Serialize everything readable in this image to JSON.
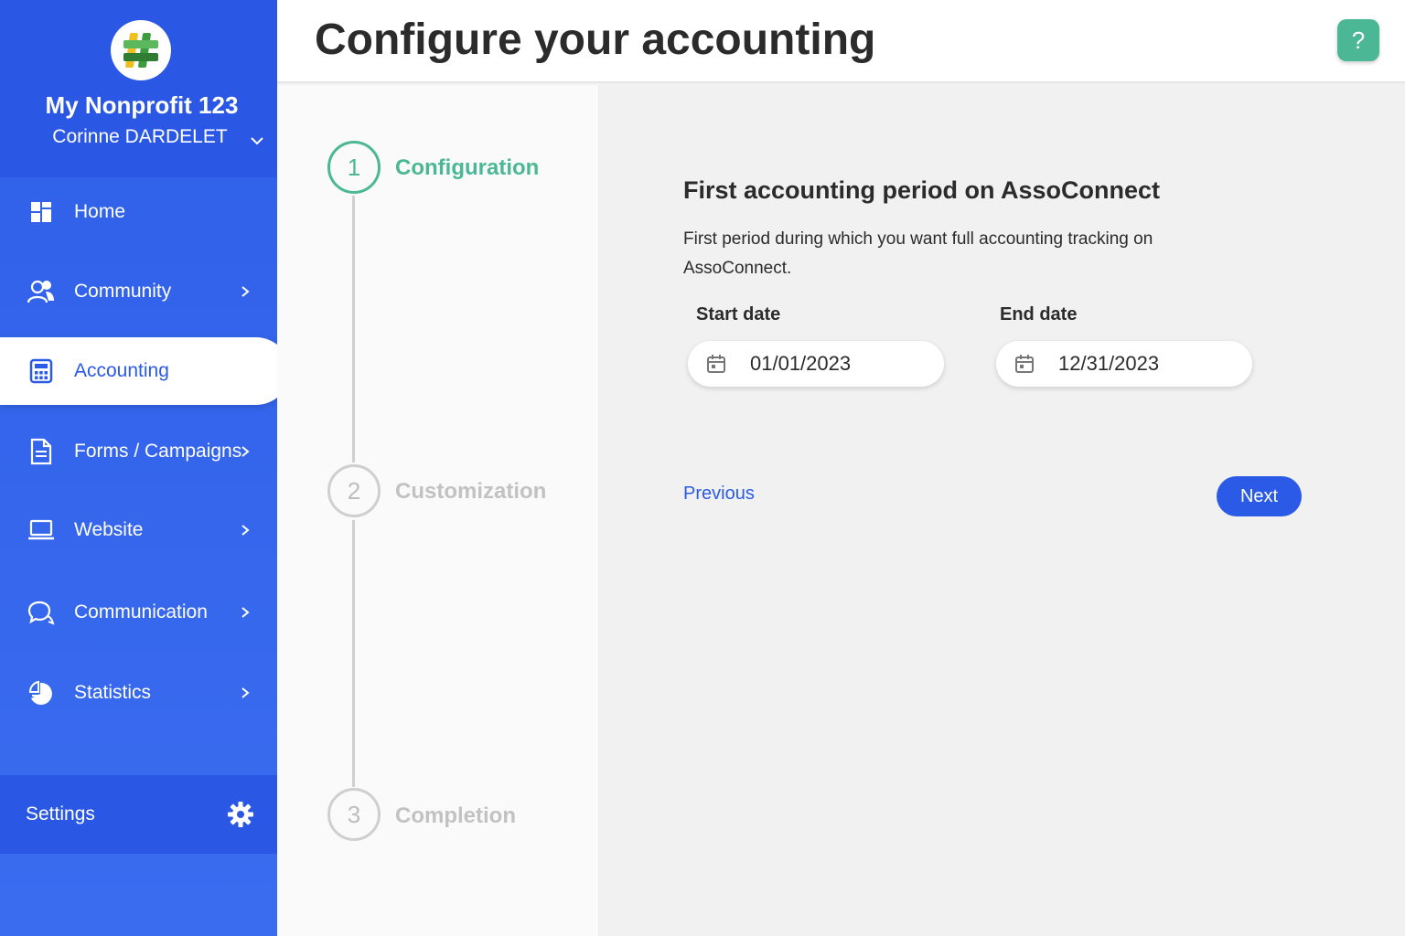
{
  "header": {
    "title": "Configure your accounting",
    "help_label": "?"
  },
  "sidebar": {
    "org_name": "My Nonprofit 123",
    "user_name": "Corinne DARDELET",
    "items": [
      {
        "label": "Home",
        "icon": "grid-icon",
        "has_chevron": false,
        "active": false
      },
      {
        "label": "Community",
        "icon": "users-icon",
        "has_chevron": true,
        "active": false
      },
      {
        "label": "Accounting",
        "icon": "calculator-icon",
        "has_chevron": false,
        "active": true
      },
      {
        "label": "Forms / Campaigns",
        "icon": "document-icon",
        "has_chevron": true,
        "active": false
      },
      {
        "label": "Website",
        "icon": "laptop-icon",
        "has_chevron": true,
        "active": false
      },
      {
        "label": "Communication",
        "icon": "chat-icon",
        "has_chevron": true,
        "active": false
      },
      {
        "label": "Statistics",
        "icon": "pie-chart-icon",
        "has_chevron": true,
        "active": false
      }
    ],
    "settings_label": "Settings"
  },
  "stepper": {
    "steps": [
      {
        "number": "1",
        "label": "Configuration",
        "active": true
      },
      {
        "number": "2",
        "label": "Customization",
        "active": false
      },
      {
        "number": "3",
        "label": "Completion",
        "active": false
      }
    ]
  },
  "main": {
    "section_title": "First accounting period on AssoConnect",
    "section_desc": "First period during which you want full accounting tracking on AssoConnect.",
    "start_date_label": "Start date",
    "start_date_value": "01/01/2023",
    "end_date_label": "End date",
    "end_date_value": "12/31/2023",
    "previous_label": "Previous",
    "next_label": "Next"
  },
  "colors": {
    "sidebar_blue": "#2f5fe8",
    "accent_green": "#4cb794",
    "link_blue": "#2a5ae6"
  }
}
